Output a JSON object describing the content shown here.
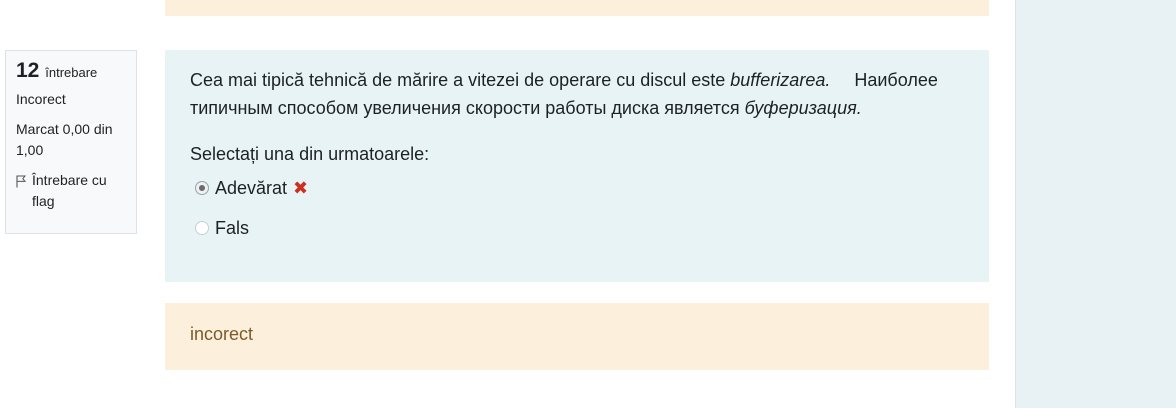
{
  "question": {
    "number": "12",
    "number_word": "întrebare",
    "state": "Incorect",
    "grade": "Marcat 0,00 din 1,00",
    "flag_label": "Întrebare cu flag"
  },
  "qtext": {
    "ro_prefix": "Cea mai tipică tehnică de mărire a vitezei de operare cu discul este ",
    "ro_emph": "bufferizarea.",
    "ru_prefix": "Наиболее типичным способом увеличения скорости работы диска является ",
    "ru_emph": "буферизация."
  },
  "prompt": "Selectați una din urmatoarele:",
  "answers": [
    {
      "label": "Adevărat",
      "checked": true,
      "mark": "✖"
    },
    {
      "label": "Fals",
      "checked": false
    }
  ],
  "feedback": "incorect",
  "colors": {
    "incorrect_mark": "#ca3120",
    "formulation_bg": "#e7f3f5",
    "feedback_bg": "#fcefdc",
    "feedback_text": "#7d5a29"
  }
}
